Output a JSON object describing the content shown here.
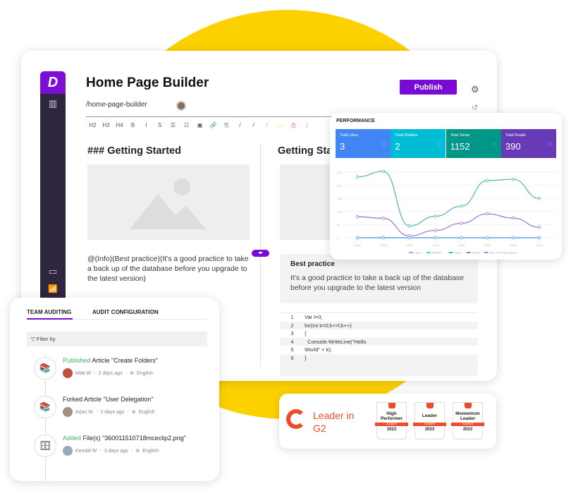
{
  "editor": {
    "title": "Home Page Builder",
    "slug": "/home-page-builder",
    "publish_label": "Publish",
    "toolbar": [
      "H2",
      "H3",
      "H4",
      "B",
      "I",
      "S",
      "☰",
      "☷",
      "▣",
      "🔗",
      "⎘",
      "/",
      "/",
      "/",
      "▭",
      "⎙",
      "⋮"
    ],
    "left_heading": "### Getting Started",
    "left_text": "@(Info)(Best practice)(It's a good practice to take a back up of the database before you upgrade to the latest version)",
    "right_heading": "Getting Started",
    "best_practice": {
      "title": "Best practice",
      "body": "It's a good practice to take a back up of the database before you upgrade to the latest version"
    },
    "code": [
      {
        "n": "1",
        "t": "Var l=0;"
      },
      {
        "n": "2",
        "t": "for(int k=0;k<=l;k++)"
      },
      {
        "n": "3",
        "t": "{"
      },
      {
        "n": "4",
        "t": "  Console.WriteLine(\"Hello"
      },
      {
        "n": "5",
        "t": "World\" + k);"
      },
      {
        "n": "6",
        "t": "}"
      }
    ]
  },
  "performance": {
    "title": "PERFORMANCE",
    "tiles": [
      {
        "label": "Total Likes",
        "value": "3",
        "color": "#4285F4"
      },
      {
        "label": "Total Dislikes",
        "value": "2",
        "color": "#00BCD4"
      },
      {
        "label": "Total Views",
        "value": "1152",
        "color": "#009688"
      },
      {
        "label": "Total Reads",
        "value": "390",
        "color": "#673AB7"
      }
    ]
  },
  "chart_data": {
    "type": "line",
    "categories": [
      "10/09",
      "11/09",
      "12/09",
      "13/09",
      "14/09",
      "15/09",
      "16/09",
      "17/09"
    ],
    "ylim": [
      0,
      250
    ],
    "yticks": [
      0,
      50,
      100,
      150,
      200,
      250
    ],
    "grid": true,
    "legend": "bottom",
    "series": [
      {
        "name": "Likes",
        "color": "#8AB4F8",
        "values": [
          0,
          1,
          0,
          0,
          0,
          0,
          0,
          0
        ]
      },
      {
        "name": "Dislikes",
        "color": "#4DD0E1",
        "values": [
          0,
          0,
          0,
          0,
          0,
          0,
          0,
          0
        ]
      },
      {
        "name": "Views",
        "color": "#4DB6AC",
        "values": [
          232,
          253,
          45,
          82,
          120,
          218,
          223,
          150
        ]
      },
      {
        "name": "Reads",
        "color": "#9575CD",
        "values": [
          80,
          74,
          7,
          28,
          55,
          91,
          75,
          40
        ]
      },
      {
        "name": "Avg. Time Spent(min)",
        "color": "#64A0F0",
        "values": [
          0,
          0,
          0,
          0,
          0,
          0,
          0,
          0
        ]
      }
    ]
  },
  "audit": {
    "tabs": [
      "TEAM AUDITING",
      "AUDIT CONFIGURATION"
    ],
    "filter_label": "Filter by",
    "items": [
      {
        "action": "Published",
        "rest": " Article \"Create Folders\"",
        "user": "Matt W",
        "time": "2 days ago",
        "lang": "English",
        "icon": "📚",
        "action_color": "#3dba6b",
        "avatar": "#c0503c"
      },
      {
        "action": "Forked",
        "rest": " Article \"User Delegation\"",
        "user": "Arjan W",
        "time": "3 days ago",
        "lang": "English",
        "icon": "📚",
        "action_color": "#222",
        "avatar": "#a09080"
      },
      {
        "action": "Added",
        "rest": " File(s) \"360011510718mceclip2.png\"",
        "user": "Kendal W",
        "time": "3 days ago",
        "lang": "English",
        "icon": "🗄",
        "action_color": "#3dba6b",
        "avatar": "#9aa8b8"
      }
    ]
  },
  "g2": {
    "text1": "Leader in",
    "text2": "G2",
    "logo_text": "G2",
    "badges": [
      {
        "name": "High Performer",
        "season": "SUMMER",
        "year": "2023"
      },
      {
        "name": "Leader",
        "season": "SUMMER",
        "year": "2023"
      },
      {
        "name": "Momentum Leader",
        "season": "SUMMER",
        "year": "2023"
      }
    ]
  }
}
